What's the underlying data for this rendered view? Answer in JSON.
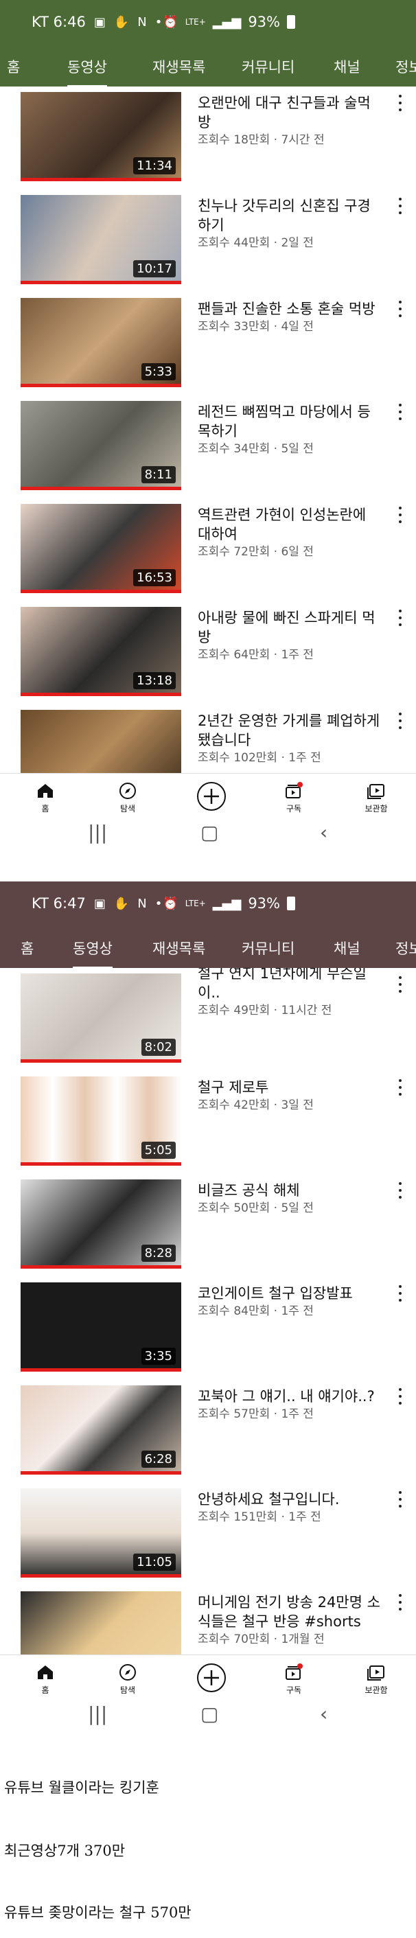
{
  "screen1": {
    "status": {
      "carrier_time": "KT 6:46",
      "battery": "93%",
      "network": "LTE+"
    },
    "header_color": "#4b6a36",
    "tabs": [
      "홈",
      "동영상",
      "재생목록",
      "커뮤니티",
      "채널",
      "정보"
    ],
    "active_tab": "동영상",
    "videos": [
      {
        "title": "오랜만에 대구 친구들과 술먹방",
        "meta": "조회수 18만회 · 7시간 전",
        "duration": "11:34"
      },
      {
        "title": "친누나 갓두리의 신혼집 구경하기",
        "meta": "조회수 44만회 · 2일 전",
        "duration": "10:17"
      },
      {
        "title": "팬들과 진솔한 소통 혼술 먹방",
        "meta": "조회수 33만회 · 4일 전",
        "duration": "5:33"
      },
      {
        "title": "레전드 뼈찜먹고 마당에서 등목하기",
        "meta": "조회수 34만회 · 5일 전",
        "duration": "8:11"
      },
      {
        "title": "역트관련 가현이 인성논란에 대하여",
        "meta": "조회수 72만회 · 6일 전",
        "duration": "16:53"
      },
      {
        "title": "아내랑 물에 빠진 스파게티 먹방",
        "meta": "조회수 64만회 · 1주 전",
        "duration": "13:18"
      },
      {
        "title": "2년간 운영한 가게를 폐업하게됐습니다",
        "meta": "조회수 102만회 · 1주 전",
        "duration": ""
      }
    ]
  },
  "screen2": {
    "status": {
      "carrier_time": "KT 6:47",
      "battery": "93%",
      "network": "LTE+"
    },
    "header_color": "#5e4545",
    "tabs": [
      "홈",
      "동영상",
      "재생목록",
      "커뮤니티",
      "채널",
      "정보"
    ],
    "active_tab": "동영상",
    "videos": [
      {
        "title": "철구 연지 1년차에게 무슨일이..",
        "meta": "조회수 49만회 · 11시간 전",
        "duration": "8:02"
      },
      {
        "title": "철구 제로투",
        "meta": "조회수 42만회 · 3일 전",
        "duration": "5:05"
      },
      {
        "title": "비글즈 공식 해체",
        "meta": "조회수 50만회 · 5일 전",
        "duration": "8:28"
      },
      {
        "title": "코인게이트 철구 입장발표",
        "meta": "조회수 84만회 · 1주 전",
        "duration": "3:35"
      },
      {
        "title": "꼬북아 그 얘기.. 내 얘기야..?",
        "meta": "조회수 57만회 · 1주 전",
        "duration": "6:28"
      },
      {
        "title": "안녕하세요 철구입니다.",
        "meta": "조회수 151만회 · 1주 전",
        "duration": "11:05"
      },
      {
        "title": "머니게임 전기 방송 24만명 소식들은 철구 반응 #shorts",
        "meta": "조회수 70만회 · 1개월 전",
        "duration": ""
      }
    ]
  },
  "bottom_nav": [
    "홈",
    "탐색",
    "",
    "구독",
    "보관함"
  ],
  "captions": [
    "유튜브 월클이라는 킹기훈",
    "최근영상7개 370만",
    "유튜브 좆망이라는 철구 570만"
  ]
}
